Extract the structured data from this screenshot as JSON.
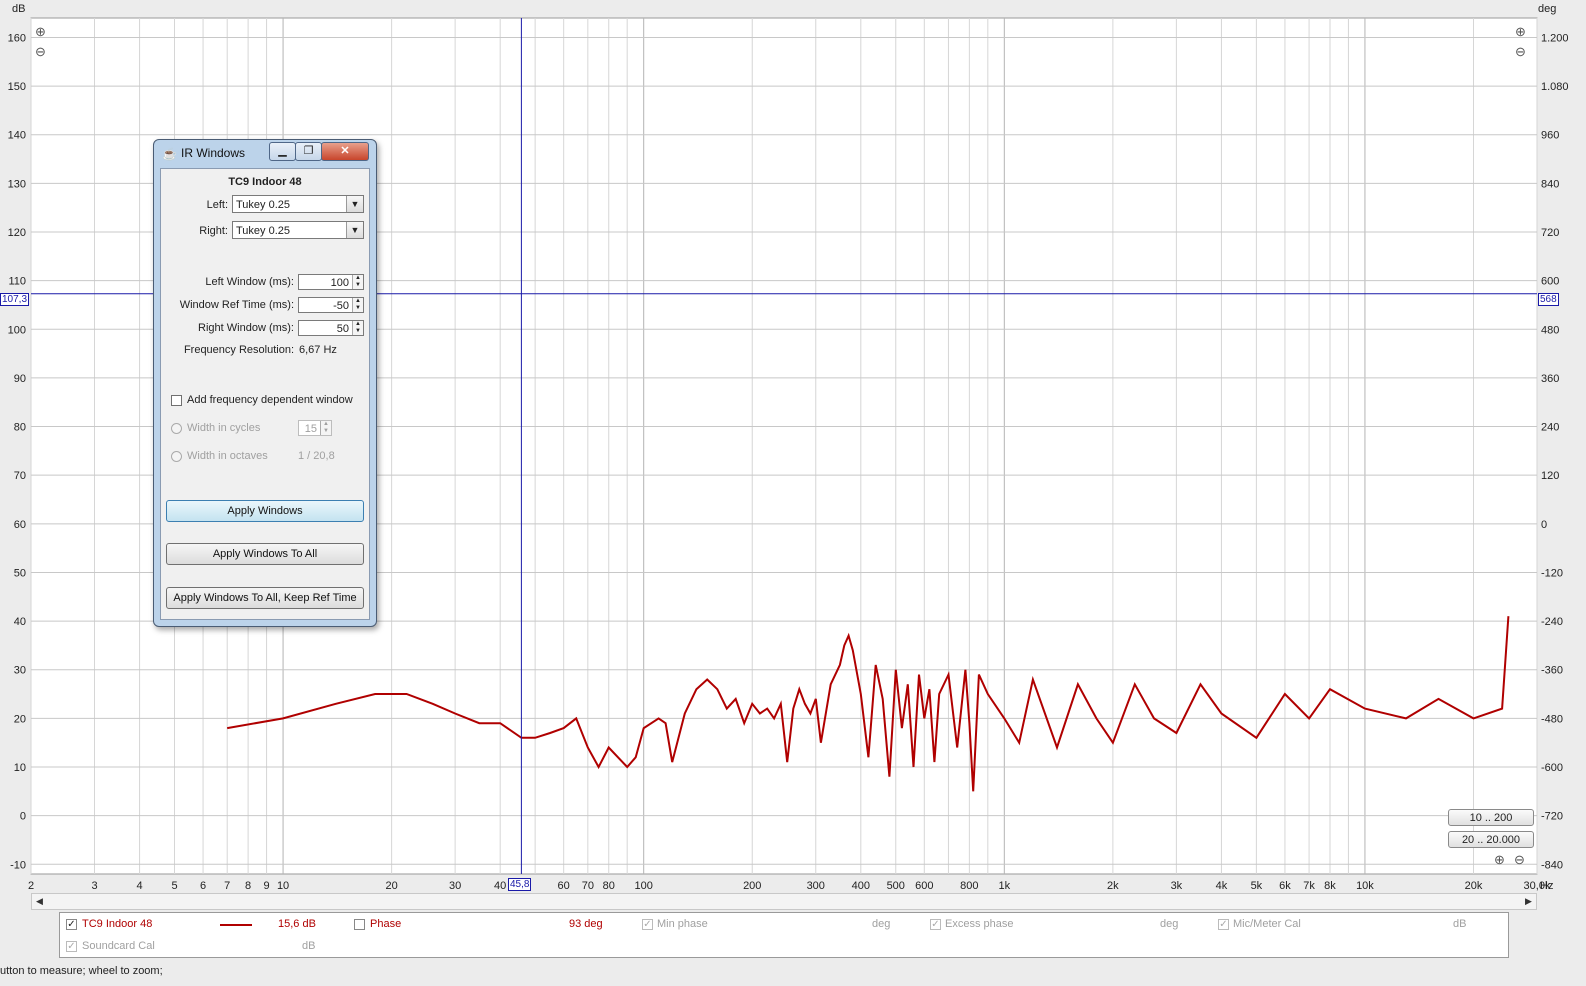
{
  "graph": {
    "left_unit": "dB",
    "right_unit": "deg",
    "x_unit": "Hz",
    "left_ticks": [
      {
        "v": 160,
        "label": "160"
      },
      {
        "v": 150,
        "label": "150"
      },
      {
        "v": 140,
        "label": "140"
      },
      {
        "v": 130,
        "label": "130"
      },
      {
        "v": 120,
        "label": "120"
      },
      {
        "v": 110,
        "label": "110"
      },
      {
        "v": 100,
        "label": "100"
      },
      {
        "v": 90,
        "label": "90"
      },
      {
        "v": 80,
        "label": "80"
      },
      {
        "v": 70,
        "label": "70"
      },
      {
        "v": 60,
        "label": "60"
      },
      {
        "v": 50,
        "label": "50"
      },
      {
        "v": 40,
        "label": "40"
      },
      {
        "v": 30,
        "label": "30"
      },
      {
        "v": 20,
        "label": "20"
      },
      {
        "v": 10,
        "label": "10"
      },
      {
        "v": 0,
        "label": "0"
      },
      {
        "v": -10,
        "label": "-10"
      }
    ],
    "right_ticks": [
      {
        "v": 160,
        "label": "1.200"
      },
      {
        "v": 150,
        "label": "1.080"
      },
      {
        "v": 140,
        "label": "960"
      },
      {
        "v": 130,
        "label": "840"
      },
      {
        "v": 120,
        "label": "720"
      },
      {
        "v": 110,
        "label": "600"
      },
      {
        "v": 100,
        "label": "480"
      },
      {
        "v": 90,
        "label": "360"
      },
      {
        "v": 80,
        "label": "240"
      },
      {
        "v": 70,
        "label": "120"
      },
      {
        "v": 60,
        "label": "0"
      },
      {
        "v": 50,
        "label": "-120"
      },
      {
        "v": 40,
        "label": "-240"
      },
      {
        "v": 30,
        "label": "-360"
      },
      {
        "v": 20,
        "label": "-480"
      },
      {
        "v": 10,
        "label": "-600"
      },
      {
        "v": 0,
        "label": "-720"
      },
      {
        "v": -10,
        "label": "-840"
      }
    ],
    "x_ticks": [
      {
        "f": 2,
        "label": "2"
      },
      {
        "f": 3,
        "label": "3"
      },
      {
        "f": 4,
        "label": "4"
      },
      {
        "f": 5,
        "label": "5"
      },
      {
        "f": 6,
        "label": "6"
      },
      {
        "f": 7,
        "label": "7"
      },
      {
        "f": 8,
        "label": "8"
      },
      {
        "f": 9,
        "label": "9"
      },
      {
        "f": 10,
        "label": "10"
      },
      {
        "f": 20,
        "label": "20"
      },
      {
        "f": 30,
        "label": "30"
      },
      {
        "f": 40,
        "label": "40"
      },
      {
        "f": 60,
        "label": "60"
      },
      {
        "f": 70,
        "label": "70"
      },
      {
        "f": 80,
        "label": "80"
      },
      {
        "f": 100,
        "label": "100"
      },
      {
        "f": 200,
        "label": "200"
      },
      {
        "f": 300,
        "label": "300"
      },
      {
        "f": 400,
        "label": "400"
      },
      {
        "f": 500,
        "label": "500"
      },
      {
        "f": 600,
        "label": "600"
      },
      {
        "f": 800,
        "label": "800"
      },
      {
        "f": 1000,
        "label": "1k"
      },
      {
        "f": 2000,
        "label": "2k"
      },
      {
        "f": 3000,
        "label": "3k"
      },
      {
        "f": 4000,
        "label": "4k"
      },
      {
        "f": 5000,
        "label": "5k"
      },
      {
        "f": 6000,
        "label": "6k"
      },
      {
        "f": 7000,
        "label": "7k"
      },
      {
        "f": 8000,
        "label": "8k"
      },
      {
        "f": 10000,
        "label": "10k"
      },
      {
        "f": 20000,
        "label": "20k"
      },
      {
        "f": 30000,
        "label": "30,0k"
      }
    ],
    "cursor": {
      "x_label": "45,8",
      "left_label": "107,3",
      "right_label": "568"
    },
    "colors": {
      "trace": "#b00000",
      "cursor": "#1a1aa8",
      "grid": "#c8c8c8",
      "plot_bg": "#ffffff"
    }
  },
  "chart_data": {
    "type": "line",
    "x_scale": "log",
    "xlim": [
      2,
      30000
    ],
    "ylim": [
      -12,
      164
    ],
    "xlabel": "Hz",
    "ylabel": "dB",
    "y2label": "deg",
    "series": [
      {
        "name": "TC9 Indoor 48",
        "x": [
          7,
          10,
          14,
          18,
          22,
          26,
          30,
          35,
          40,
          45.8,
          50,
          55,
          60,
          65,
          70,
          75,
          80,
          90,
          95,
          100,
          110,
          115,
          120,
          130,
          140,
          150,
          160,
          170,
          180,
          190,
          200,
          210,
          220,
          230,
          240,
          250,
          260,
          270,
          280,
          290,
          300,
          310,
          330,
          350,
          360,
          370,
          380,
          400,
          420,
          440,
          460,
          480,
          500,
          520,
          540,
          560,
          580,
          600,
          620,
          640,
          660,
          700,
          740,
          780,
          800,
          820,
          850,
          900,
          1000,
          1100,
          1200,
          1400,
          1600,
          1800,
          2000,
          2300,
          2600,
          3000,
          3500,
          4000,
          5000,
          6000,
          7000,
          8000,
          10000,
          13000,
          16000,
          20000,
          24000,
          25000
        ],
        "y": [
          18,
          20,
          23,
          25,
          25,
          23,
          21,
          19,
          19,
          16,
          16,
          17,
          18,
          20,
          14,
          10,
          14,
          10,
          12,
          18,
          20,
          19,
          11,
          21,
          26,
          28,
          26,
          22,
          24,
          19,
          23,
          21,
          22,
          20,
          23,
          11,
          22,
          26,
          23,
          21,
          24,
          15,
          27,
          31,
          35,
          37,
          34,
          25,
          12,
          31,
          24,
          8,
          30,
          18,
          27,
          10,
          29,
          20,
          26,
          11,
          25,
          29,
          14,
          30,
          19,
          5,
          29,
          25,
          20,
          15,
          28,
          14,
          27,
          20,
          15,
          27,
          20,
          17,
          27,
          21,
          16,
          25,
          20,
          26,
          22,
          20,
          24,
          20,
          22,
          41
        ]
      }
    ]
  },
  "dialog": {
    "title": "IR Windows",
    "minimize": "▁",
    "maximize": "❐",
    "close": "✕",
    "measurement_name": "TC9 Indoor 48",
    "left_label": "Left:",
    "left_value": "Tukey 0.25",
    "right_label": "Right:",
    "right_value": "Tukey 0.25",
    "left_window_label": "Left Window (ms):",
    "left_window_value": "100",
    "ref_time_label": "Window Ref Time (ms):",
    "ref_time_value": "-50",
    "right_window_label": "Right Window (ms):",
    "right_window_value": "50",
    "freq_res_label": "Frequency Resolution:",
    "freq_res_value": "6,67 Hz",
    "add_fdw_label": "Add frequency dependent window",
    "width_cycles_label": "Width in cycles",
    "width_cycles_value": "15",
    "width_octaves_label": "Width in octaves",
    "width_octaves_value": "1 / 20,8",
    "apply_label": "Apply Windows",
    "apply_all_label": "Apply Windows To All",
    "apply_all_keep_label": "Apply Windows To All, Keep Ref Time"
  },
  "range_buttons": {
    "r1": "10 .. 200",
    "r2": "20 .. 20.000"
  },
  "legend": {
    "measurement": "TC9 Indoor 48",
    "level": "15,6 dB",
    "phase_label": "Phase",
    "phase_value": "93 deg",
    "min_phase_label": "Min phase",
    "min_phase_unit": "deg",
    "excess_phase_label": "Excess phase",
    "excess_phase_unit": "deg",
    "mic_cal_label": "Mic/Meter Cal",
    "mic_cal_unit": "dB",
    "soundcard_label": "Soundcard Cal",
    "soundcard_unit": "dB"
  },
  "status_text": "utton to measure; wheel to zoom;"
}
